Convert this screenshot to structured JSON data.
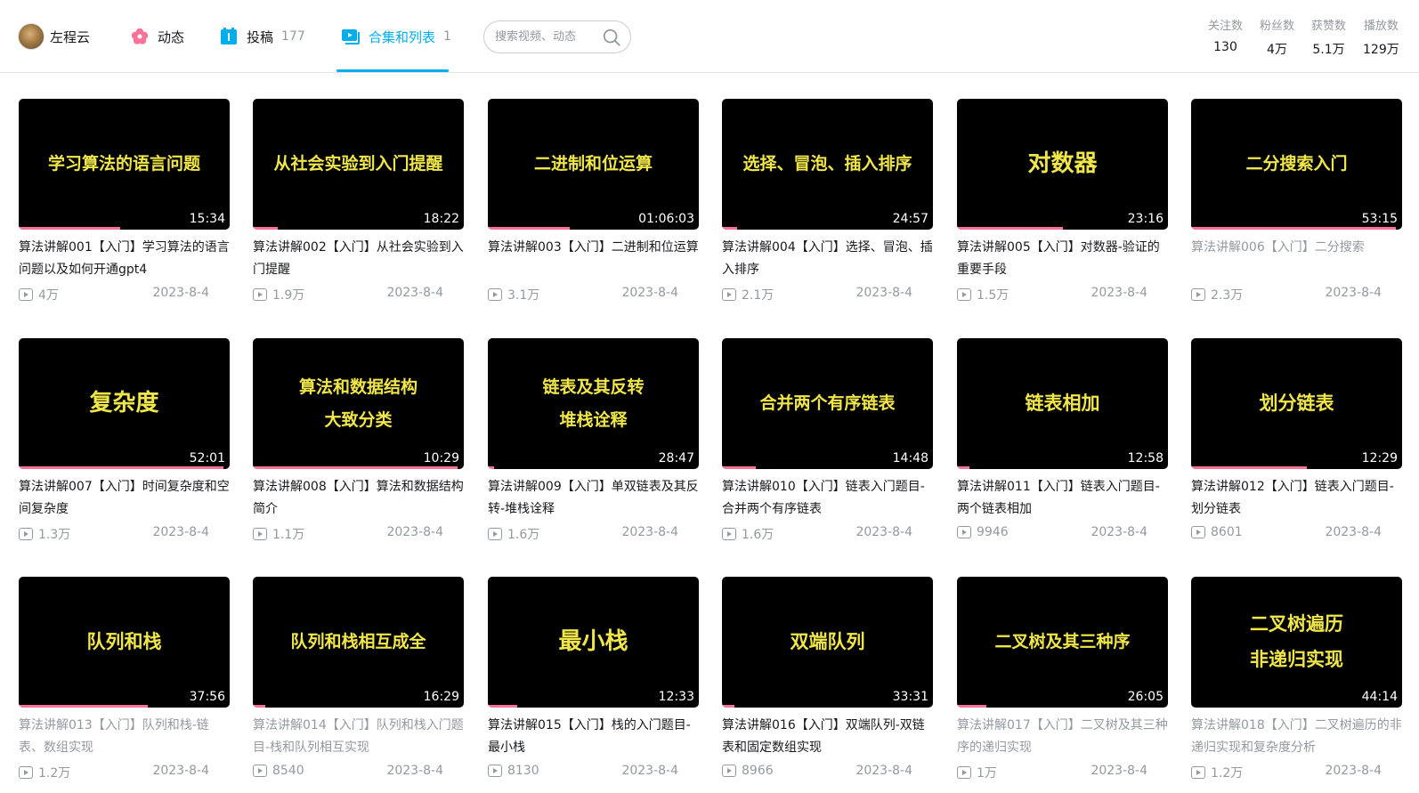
{
  "nav": {
    "user_name": "左程云",
    "dynamics_label": "动态",
    "uploads_label": "投稿",
    "uploads_count": "177",
    "collections_label": "合集和列表",
    "collections_count": "1",
    "search_placeholder": "搜索视频、动态"
  },
  "stats": [
    {
      "label": "关注数",
      "value": "130"
    },
    {
      "label": "粉丝数",
      "value": "4万"
    },
    {
      "label": "获赞数",
      "value": "5.1万"
    },
    {
      "label": "播放数",
      "value": "129万"
    }
  ],
  "videos": [
    {
      "thumb_lines": [
        "学习算法的语言问题"
      ],
      "duration": "15:34",
      "progress": 0.48,
      "title": "算法讲解001【入门】学习算法的语言问题以及如何开通gpt4",
      "plays": "4万",
      "date": "2023-8-4",
      "watched": false
    },
    {
      "thumb_lines": [
        "从社会实验到入门提醒"
      ],
      "duration": "18:22",
      "progress": 0.12,
      "title": "算法讲解002【入门】从社会实验到入门提醒",
      "plays": "1.9万",
      "date": "2023-8-4",
      "watched": false
    },
    {
      "thumb_lines": [
        "二进制和位运算"
      ],
      "duration": "01:06:03",
      "progress": 0.39,
      "title": "算法讲解003【入门】二进制和位运算",
      "plays": "3.1万",
      "date": "2023-8-4",
      "watched": false
    },
    {
      "thumb_lines": [
        "选择、冒泡、插入排序"
      ],
      "duration": "24:57",
      "progress": 0.07,
      "title": "算法讲解004【入门】选择、冒泡、插入排序",
      "plays": "2.1万",
      "date": "2023-8-4",
      "watched": false
    },
    {
      "thumb_lines": [
        "对数器"
      ],
      "duration": "23:16",
      "progress": 0.5,
      "title": "算法讲解005【入门】对数器-验证的重要手段",
      "plays": "1.5万",
      "date": "2023-8-4",
      "watched": false
    },
    {
      "thumb_lines": [
        "二分搜索入门"
      ],
      "duration": "53:15",
      "progress": 0.97,
      "title": "算法讲解006【入门】二分搜索",
      "plays": "2.3万",
      "date": "2023-8-4",
      "watched": true
    },
    {
      "thumb_lines": [
        "复杂度"
      ],
      "duration": "52:01",
      "progress": 0.97,
      "title": "算法讲解007【入门】时间复杂度和空间复杂度",
      "plays": "1.3万",
      "date": "2023-8-4",
      "watched": false
    },
    {
      "thumb_lines": [
        "算法和数据结构",
        "大致分类"
      ],
      "duration": "10:29",
      "progress": 0.97,
      "title": "算法讲解008【入门】算法和数据结构简介",
      "plays": "1.1万",
      "date": "2023-8-4",
      "watched": false
    },
    {
      "thumb_lines": [
        "链表及其反转",
        "堆栈诠释"
      ],
      "duration": "28:47",
      "progress": 0.03,
      "title": "算法讲解009【入门】单双链表及其反转-堆栈诠释",
      "plays": "1.6万",
      "date": "2023-8-4",
      "watched": false
    },
    {
      "thumb_lines": [
        "合并两个有序链表"
      ],
      "duration": "14:48",
      "progress": 0.16,
      "title": "算法讲解010【入门】链表入门题目-合并两个有序链表",
      "plays": "1.6万",
      "date": "2023-8-4",
      "watched": false
    },
    {
      "thumb_lines": [
        "链表相加"
      ],
      "duration": "12:58",
      "progress": 0.06,
      "title": "算法讲解011【入门】链表入门题目-两个链表相加",
      "plays": "9946",
      "date": "2023-8-4",
      "watched": false
    },
    {
      "thumb_lines": [
        "划分链表"
      ],
      "duration": "12:29",
      "progress": 0.55,
      "title": "算法讲解012【入门】链表入门题目-划分链表",
      "plays": "8601",
      "date": "2023-8-4",
      "watched": false
    },
    {
      "thumb_lines": [
        "队列和栈"
      ],
      "duration": "37:56",
      "progress": 0.61,
      "title": "算法讲解013【入门】队列和栈-链表、数组实现",
      "plays": "1.2万",
      "date": "2023-8-4",
      "watched": true
    },
    {
      "thumb_lines": [
        "队列和栈相互成全"
      ],
      "duration": "16:29",
      "progress": 0.06,
      "title": "算法讲解014【入门】队列和栈入门题目-栈和队列相互实现",
      "plays": "8540",
      "date": "2023-8-4",
      "watched": true
    },
    {
      "thumb_lines": [
        "最小栈"
      ],
      "duration": "12:33",
      "progress": 0.14,
      "title": "算法讲解015【入门】栈的入门题目-最小栈",
      "plays": "8130",
      "date": "2023-8-4",
      "watched": false
    },
    {
      "thumb_lines": [
        "双端队列"
      ],
      "duration": "33:31",
      "progress": 0.06,
      "title": "算法讲解016【入门】双端队列-双链表和固定数组实现",
      "plays": "8966",
      "date": "2023-8-4",
      "watched": false
    },
    {
      "thumb_lines": [
        "二叉树及其三种序"
      ],
      "duration": "26:05",
      "progress": 0.14,
      "title": "算法讲解017【入门】二叉树及其三种序的递归实现",
      "plays": "1万",
      "date": "2023-8-4",
      "watched": true
    },
    {
      "thumb_lines": [
        "二叉树遍历",
        "非递归实现"
      ],
      "duration": "44:14",
      "progress": 0.0,
      "title": "算法讲解018【入门】二叉树遍历的非递归实现和复杂度分析",
      "plays": "1.2万",
      "date": "2023-8-4",
      "watched": true
    }
  ]
}
